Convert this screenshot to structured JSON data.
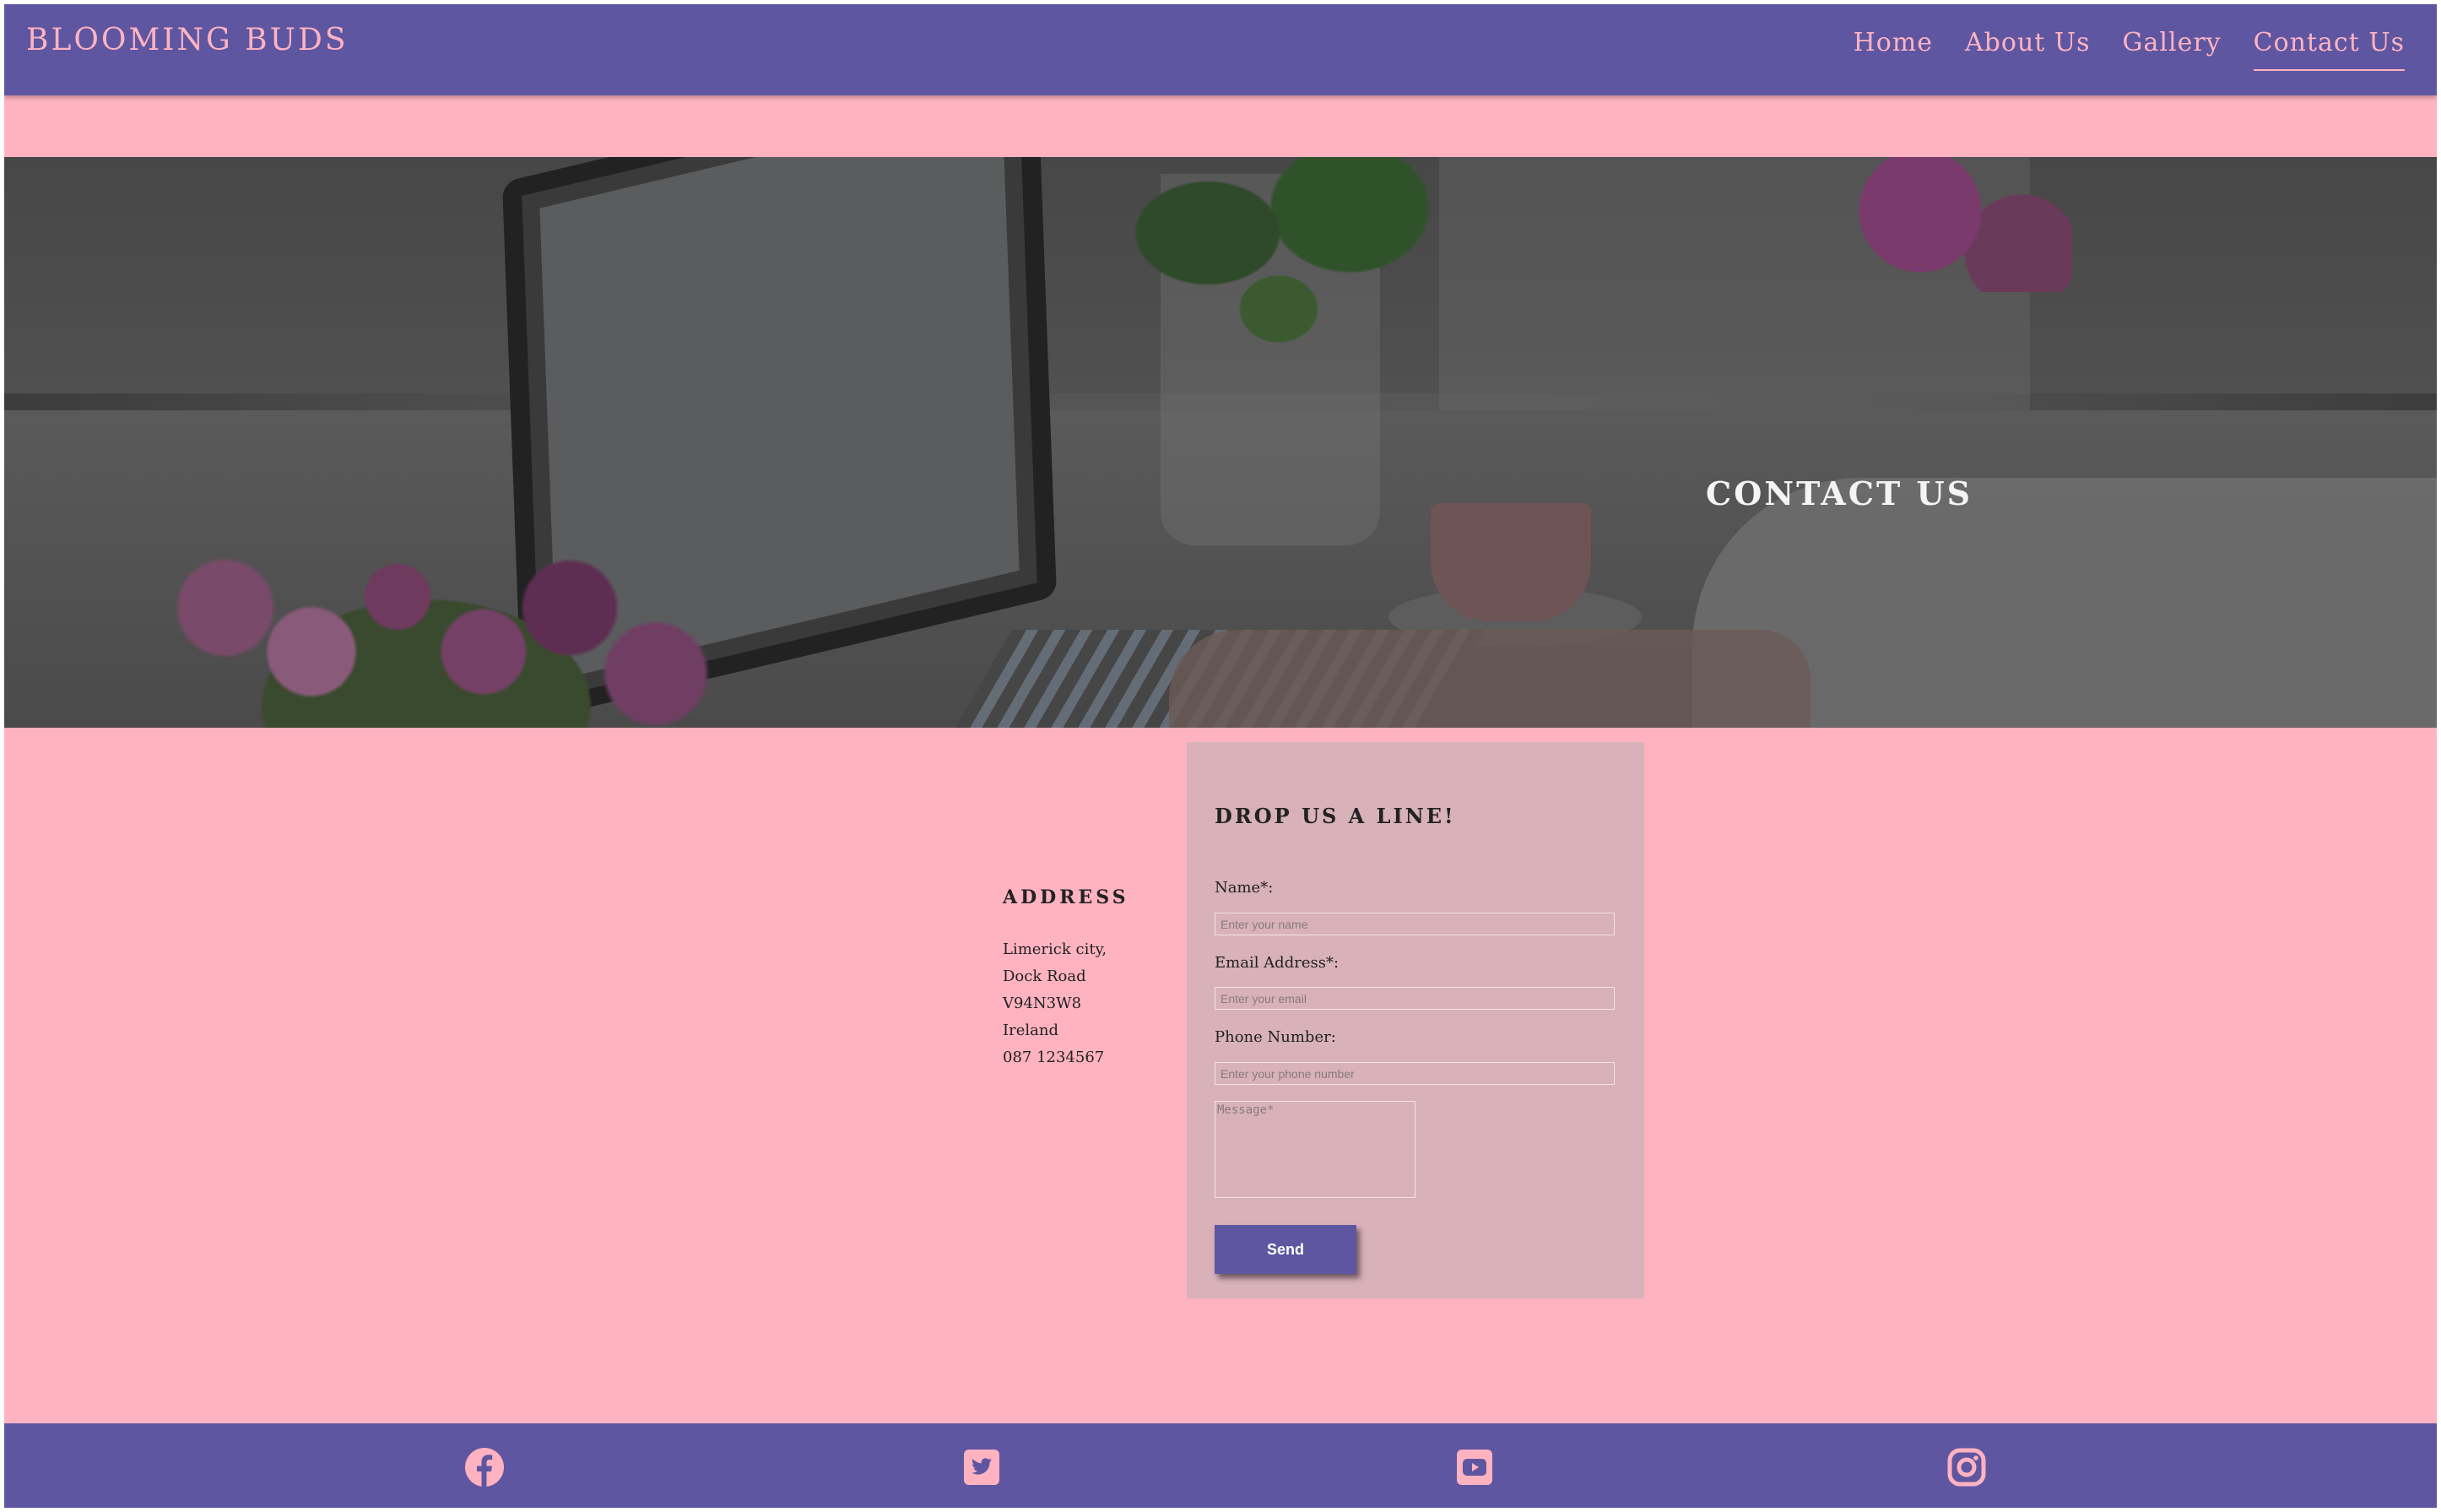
{
  "brand": {
    "name": "BLOOMING BUDS"
  },
  "nav": {
    "items": [
      {
        "label": "Home"
      },
      {
        "label": "About Us"
      },
      {
        "label": "Gallery"
      },
      {
        "label": "Contact Us",
        "active": true
      }
    ]
  },
  "hero": {
    "title": "CONTACT US"
  },
  "address": {
    "heading": "ADDRESS",
    "lines": [
      "Limerick city,",
      "Dock Road",
      "V94N3W8",
      "Ireland",
      "087 1234567"
    ]
  },
  "form": {
    "title": "DROP US A LINE!",
    "name_label": "Name*:",
    "name_placeholder": "Enter your name",
    "email_label": "Email Address*:",
    "email_placeholder": "Enter your email",
    "phone_label": "Phone Number:",
    "phone_placeholder": "Enter your phone number",
    "message_placeholder": "Message*",
    "send_label": "Send"
  },
  "footer": {
    "social": [
      {
        "icon": "facebook-icon"
      },
      {
        "icon": "twitter-icon"
      },
      {
        "icon": "youtube-icon"
      },
      {
        "icon": "instagram-icon"
      }
    ]
  },
  "colors": {
    "primary": "#5f56a1",
    "background": "#ffb3c1",
    "form_card": "#d8b1b9",
    "accent_text": "#ffb3c1"
  }
}
